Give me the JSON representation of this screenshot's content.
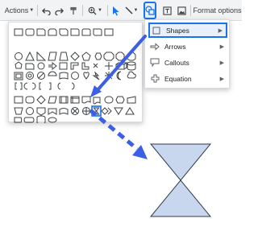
{
  "toolbar": {
    "actions_label": "Actions",
    "zoom_label": "",
    "format_options_label": "Format options"
  },
  "submenu": {
    "items": [
      {
        "label": "Shapes",
        "icon": "square-icon"
      },
      {
        "label": "Arrows",
        "icon": "arrow-icon"
      },
      {
        "label": "Callouts",
        "icon": "callout-icon"
      },
      {
        "label": "Equation",
        "icon": "plus-icon"
      }
    ]
  },
  "shapes_panel": {
    "selected_shape": "collate-hourglass"
  },
  "colors": {
    "accent": "#1a73e8",
    "arrow": "#3b5fe6",
    "hourglass_fill": "#c9d7ee",
    "hourglass_stroke": "#2f3a4a"
  }
}
